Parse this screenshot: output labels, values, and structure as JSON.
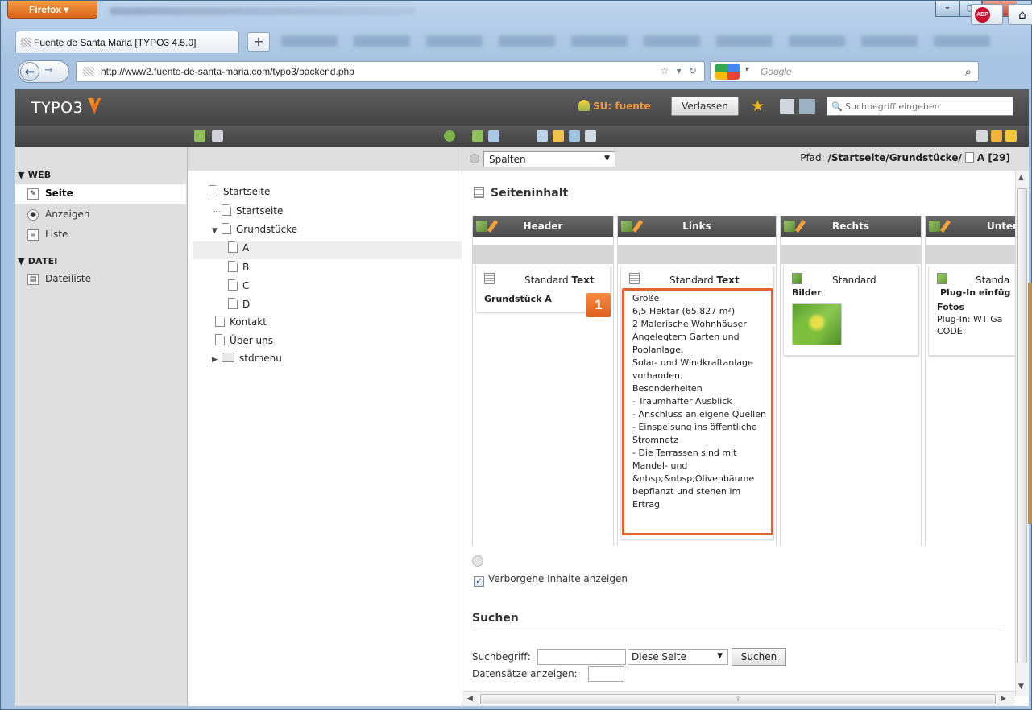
{
  "browser": {
    "app_menu": "Firefox",
    "tab_title": "Fuente de Santa Maria [TYPO3 4.5.0]",
    "new_tab_label": "+",
    "url": "http://www2.fuente-de-santa-maria.com/typo3/backend.php",
    "search_placeholder": "Google"
  },
  "t3": {
    "logo": "TYPO3",
    "su_label": "SU: fuente",
    "leave_button": "Verlassen",
    "search_placeholder": "Suchbegriff eingeben"
  },
  "modules": {
    "web_header": "▼ WEB",
    "items_web": [
      {
        "label": "Seite"
      },
      {
        "label": "Anzeigen"
      },
      {
        "label": "Liste"
      }
    ],
    "datei_header": "▼ DATEI",
    "items_datei": [
      {
        "label": "Dateiliste"
      }
    ]
  },
  "tree": {
    "nodes": [
      {
        "label": "Startseite"
      },
      {
        "label": "Startseite"
      },
      {
        "label": "Grundstücke"
      },
      {
        "label": "A"
      },
      {
        "label": "B"
      },
      {
        "label": "C"
      },
      {
        "label": "D"
      },
      {
        "label": "Kontakt"
      },
      {
        "label": "Über uns"
      },
      {
        "label": "stdmenu"
      }
    ]
  },
  "content": {
    "view_select": "Spalten",
    "path_label": "Pfad:",
    "path_value": "/Startseite/Grundstücke/",
    "path_page": "A [29]",
    "section_title": "Seiteninhalt",
    "columns": [
      {
        "name": "Header",
        "type": "Standard",
        "type_bold": "Text",
        "title": "Grundstück A"
      },
      {
        "name": "Links",
        "type": "Standard",
        "type_bold": "Text",
        "title": ""
      },
      {
        "name": "Rechts",
        "type": "Standard",
        "type_bold": "",
        "title": "Bilder"
      },
      {
        "name": "Unter",
        "type": "Standa",
        "type_bold": "",
        "title": "Plug-In einfüg"
      }
    ],
    "links_body": "Größe\n6,5 Hektar (65.827 m²)\n2 Malerische Wohnhäuser\nAngelegtem Garten und Poolanlage.\nSolar- und Windkraftanlage vorhanden.\nBesonderheiten\n- Traumhafter Ausblick\n- Anschluss an eigene Quellen\n- Einspeisung ins öffentliche Stromnetz\n- Die Terrassen sind mit Mandel- und &nbsp;&nbsp;Olivenbäume bepflanzt und stehen im Ertrag",
    "unter_fotos": "Fotos",
    "unter_plugin": "Plug-In: WT Ga",
    "unter_code": "CODE:",
    "callout_number": "1",
    "hidden_checkbox": "Verborgene Inhalte anzeigen",
    "search_section": "Suchen",
    "search_label": "Suchbegriff:",
    "scope_select": "Diese Seite",
    "search_button": "Suchen",
    "records_label": "Datensätze anzeigen:",
    "scroll_mark": "III"
  },
  "colors": {
    "accent": "#e4632b",
    "t3_dark": "#4a4a4a",
    "su_orange": "#f49a3c"
  }
}
